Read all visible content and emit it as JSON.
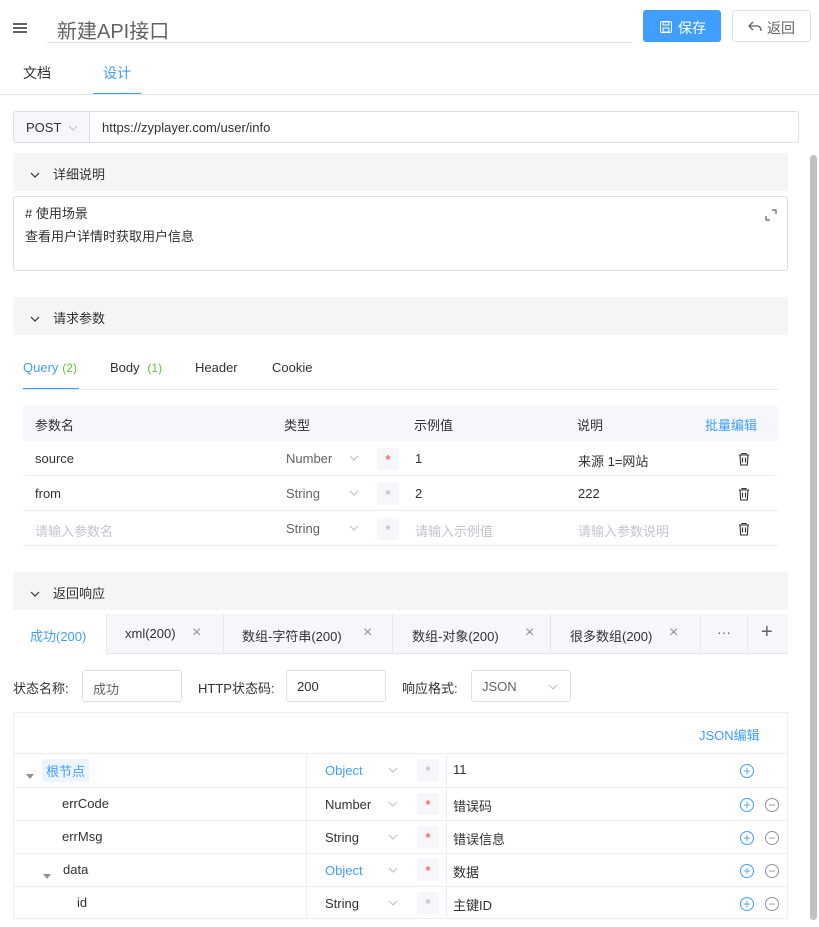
{
  "header": {
    "title": "新建API接口",
    "save_label": "保存",
    "back_label": "返回",
    "tabs": [
      {
        "label": "文档"
      },
      {
        "label": "设计"
      }
    ]
  },
  "request": {
    "method": "POST",
    "url": "https://zyplayer.com/user/info"
  },
  "detail": {
    "section_label": "详细说明",
    "lines": [
      "# 使用场景",
      "查看用户详情时获取用户信息"
    ]
  },
  "params": {
    "section_label": "请求参数",
    "tabs": [
      {
        "label": "Query",
        "count": "(2)"
      },
      {
        "label": "Body",
        "count": "(1)"
      },
      {
        "label": "Header",
        "count": ""
      },
      {
        "label": "Cookie",
        "count": ""
      }
    ],
    "columns": {
      "name": "参数名",
      "type": "类型",
      "example": "示例值",
      "desc": "说明",
      "bulk_edit": "批量编辑"
    },
    "rows": [
      {
        "name": "source",
        "type": "Number",
        "required": true,
        "example": "1",
        "desc": "来源 1=网站"
      },
      {
        "name": "from",
        "type": "String",
        "required": false,
        "example": "2",
        "desc": "222"
      }
    ],
    "new_row": {
      "name_placeholder": "请输入参数名",
      "type": "String",
      "example_placeholder": "请输入示例值",
      "desc_placeholder": "请输入参数说明"
    }
  },
  "response": {
    "section_label": "返回响应",
    "tabs": [
      {
        "label": "成功(200)",
        "closable": false
      },
      {
        "label": "xml(200)",
        "closable": true
      },
      {
        "label": "数组-字符串(200)",
        "closable": true
      },
      {
        "label": "数组-对象(200)",
        "closable": true
      },
      {
        "label": "很多数组(200)",
        "closable": true
      }
    ],
    "more_label": "···",
    "add_label": "+",
    "status_name_label": "状态名称:",
    "status_name_value": "成功",
    "http_code_label": "HTTP状态码:",
    "http_code_value": "200",
    "format_label": "响应格式:",
    "format_value": "JSON",
    "json_edit_label": "JSON编辑",
    "tree": [
      {
        "name": "根节点",
        "type": "Object",
        "required": false,
        "desc": "11",
        "is_root": true
      },
      {
        "name": "errCode",
        "type": "Number",
        "required": true,
        "desc": "错误码"
      },
      {
        "name": "errMsg",
        "type": "String",
        "required": true,
        "desc": "错误信息"
      },
      {
        "name": "data",
        "type": "Object",
        "required": true,
        "desc": "数据"
      },
      {
        "name": "id",
        "type": "String",
        "required": false,
        "desc": "主键ID"
      }
    ]
  },
  "colors": {
    "primary": "#409eff",
    "danger": "#f56c6c",
    "success": "#67c23a",
    "border": "#dcdfe6",
    "section_bg": "#f5f5f5"
  }
}
